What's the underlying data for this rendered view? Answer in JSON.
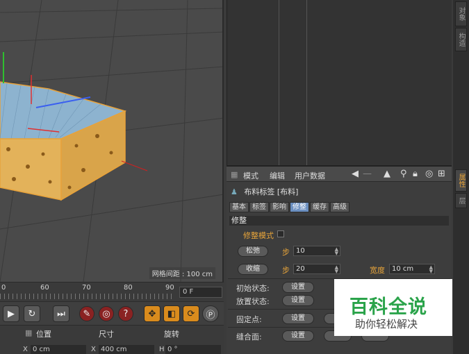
{
  "viewport": {
    "grid_spacing": "网格间距 : 100 cm"
  },
  "timeline": {
    "ticks": [
      "0",
      "60",
      "70",
      "80",
      "90"
    ],
    "frame": "0 F"
  },
  "coords": {
    "headers": [
      "位置",
      "尺寸",
      "旋转"
    ],
    "row1": {
      "pos": "0 cm",
      "size": "400 cm",
      "rot": "0 °"
    },
    "axis_labels": [
      "X",
      "X",
      "H"
    ]
  },
  "sidetabs": {
    "top": [
      "对象",
      "构造"
    ],
    "bottom": [
      "属性",
      "层"
    ]
  },
  "attributes": {
    "menu": [
      "模式",
      "编辑",
      "用户数据"
    ],
    "object_title": "布料标签 [布料]",
    "tabs": [
      "基本",
      "标签",
      "影响",
      "修整",
      "缓存",
      "高级"
    ],
    "active_tab": "修整",
    "section": "修整",
    "dress_mode_label": "修整模式",
    "relax_btn": "松弛",
    "step_label": "步",
    "relax_steps": "10",
    "shrink_btn": "收缩",
    "shrink_steps": "20",
    "width_label": "宽度",
    "width_value": "10 cm",
    "init_state_label": "初始状态:",
    "pose_state_label": "放置状态:",
    "set_btn": "设置",
    "fix_points_label": "固定点:",
    "seam_label": "缝合面:"
  },
  "watermark": {
    "title": "百科全说",
    "subtitle": "助你轻松解决"
  }
}
